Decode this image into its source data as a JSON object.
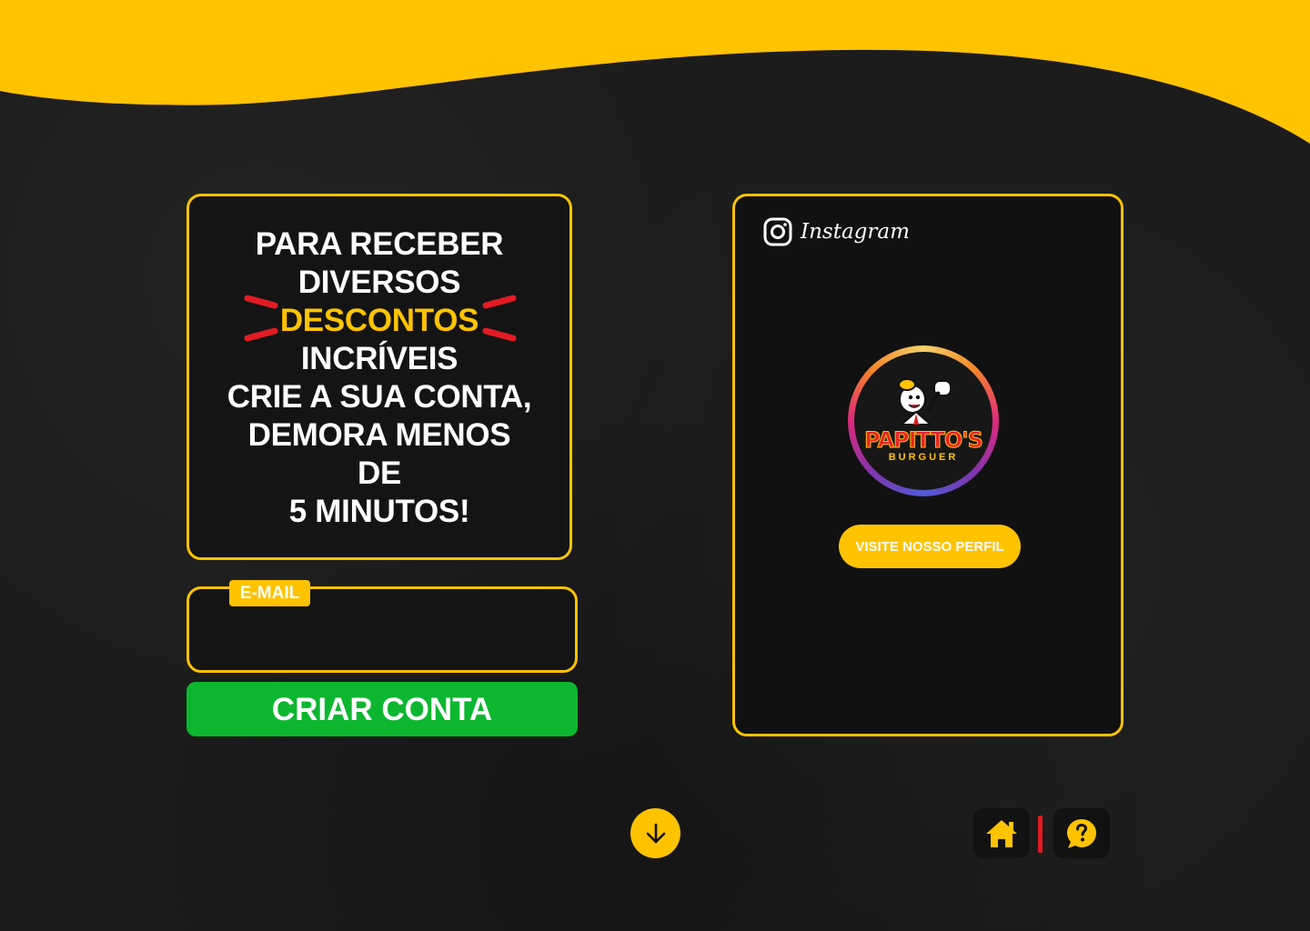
{
  "colors": {
    "accent": "#ffc300",
    "background": "#1d1d1d",
    "success": "#0cb72f",
    "burst": "#e21b23"
  },
  "promo": {
    "lines": [
      "PARA RECEBER",
      "DIVERSOS",
      "DESCONTOS",
      "INCRÍVEIS",
      "CRIE A SUA CONTA,",
      "DEMORA MENOS",
      "DE",
      "5 MINUTOS!"
    ]
  },
  "form": {
    "email_label": "E-MAIL",
    "email_value": "",
    "submit_label": "CRIAR CONTA"
  },
  "instagram": {
    "wordmark": "Instagram",
    "brand_name": "PAPITTO'S",
    "brand_sub": "BURGUER",
    "visit_label": "VISITE NOSSO PERFIL"
  },
  "icons": {
    "scroll": "arrow-down-icon",
    "home": "home-icon",
    "help": "help-chat-icon",
    "instagram": "instagram-icon"
  }
}
